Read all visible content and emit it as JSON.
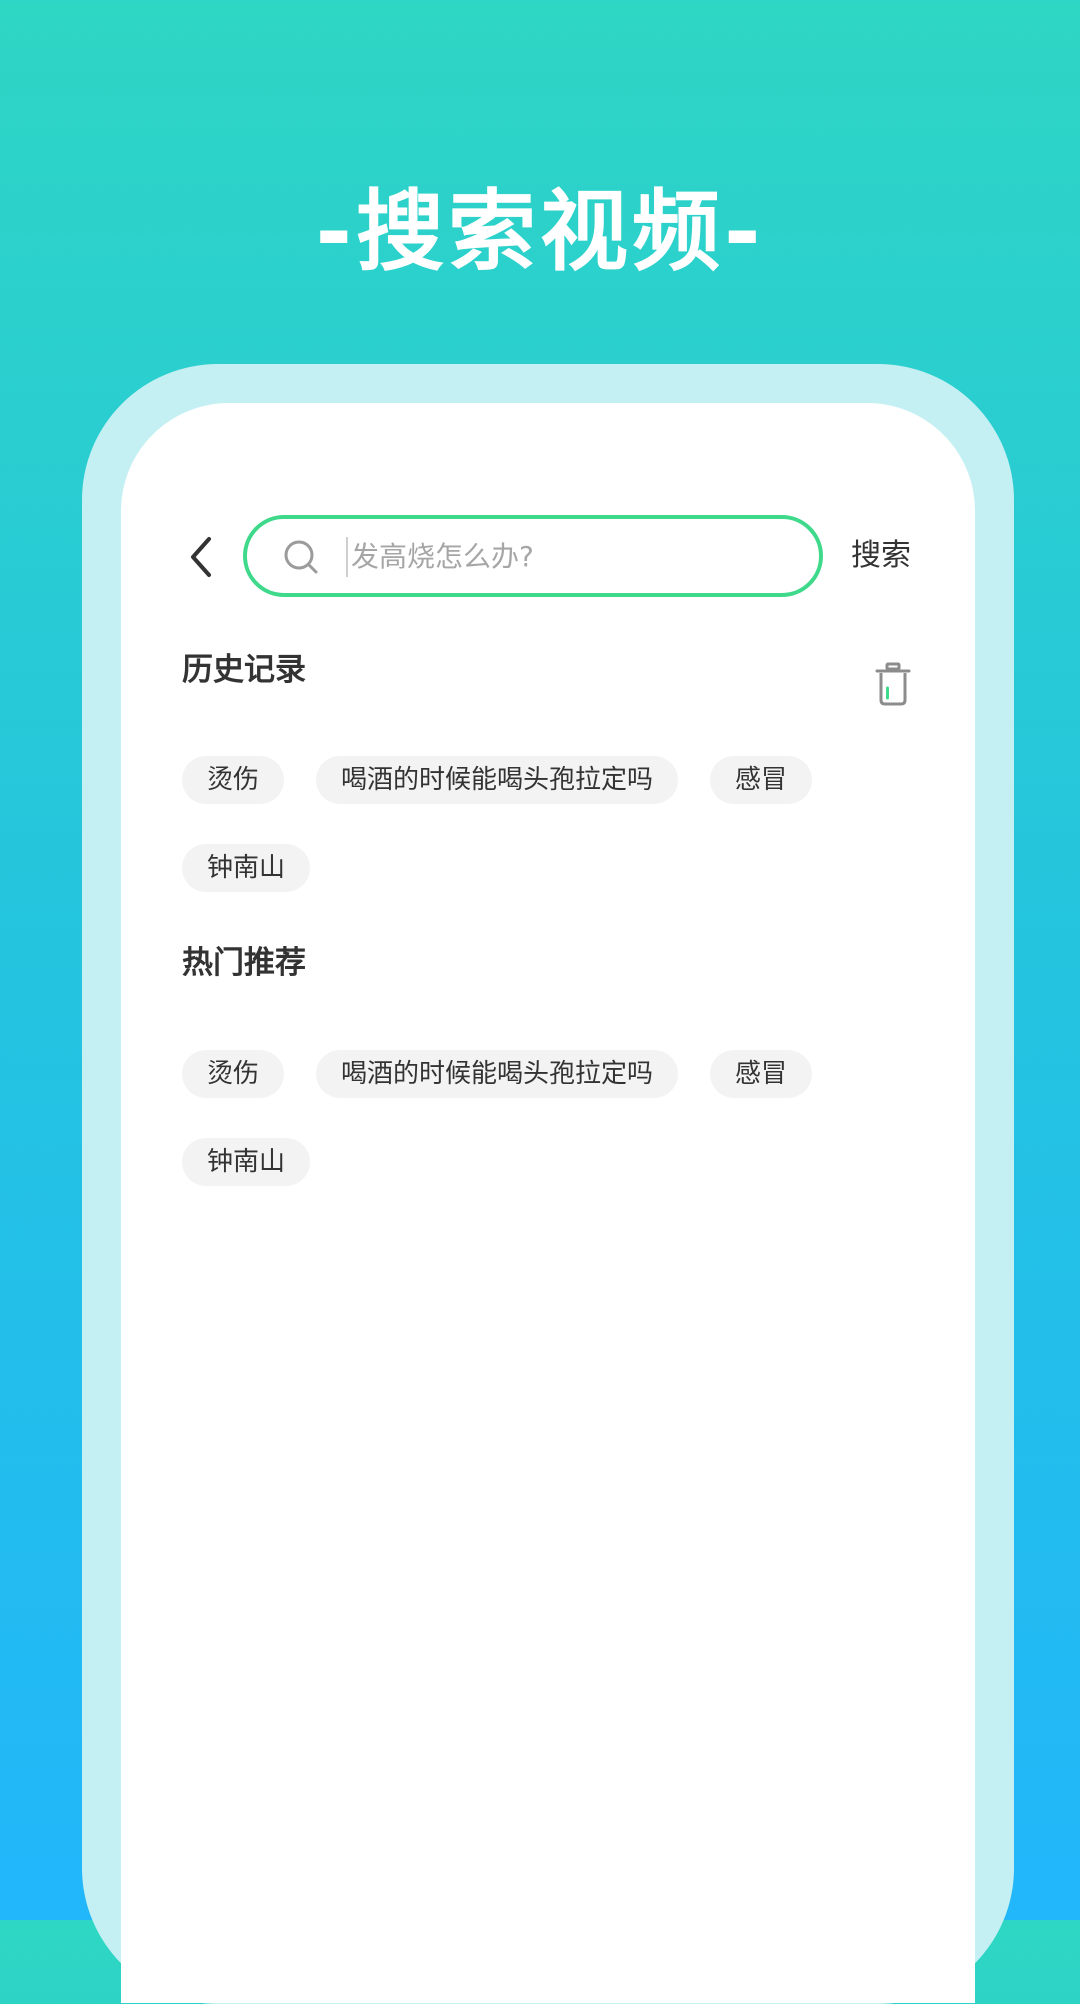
{
  "headline": "-搜索视频-",
  "search": {
    "placeholder": "发高烧怎么办?",
    "button_label": "搜索"
  },
  "history": {
    "title": "历史记录",
    "tags": [
      "烫伤",
      "喝酒的时候能喝头孢拉定吗",
      "感冒",
      "钟南山"
    ]
  },
  "hot": {
    "title": "热门推荐",
    "tags": [
      "烫伤",
      "喝酒的时候能喝头孢拉定吗",
      "感冒",
      "钟南山"
    ]
  },
  "colors": {
    "accent": "#3fd98c",
    "bg_top": "#2ed6c4",
    "bg_bottom": "#22b6fb",
    "tag_bg": "#f3f3f3"
  },
  "icons": {
    "back": "chevron-left-icon",
    "search": "search-icon",
    "trash": "trash-icon"
  }
}
